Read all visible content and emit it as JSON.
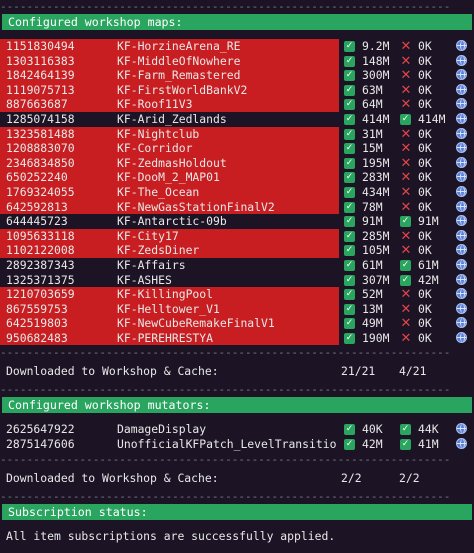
{
  "dash_line": "--------------------------------------------------------------------",
  "maps_header": "Configured workshop maps:",
  "maps": [
    {
      "id": "1151830494",
      "name": "KF-HorzineArena_RE",
      "s1": "9.2M",
      "ok2": false,
      "s2": "0K",
      "red": true
    },
    {
      "id": "1303116383",
      "name": "KF-MiddleOfNowhere",
      "s1": "148M",
      "ok2": false,
      "s2": "0K",
      "red": true
    },
    {
      "id": "1842464139",
      "name": "KF-Farm_Remastered",
      "s1": "300M",
      "ok2": false,
      "s2": "0K",
      "red": true
    },
    {
      "id": "1119075713",
      "name": "KF-FirstWorldBankV2",
      "s1": "63M",
      "ok2": false,
      "s2": "0K",
      "red": true
    },
    {
      "id": "887663687",
      "name": "KF-Roof11V3",
      "s1": "64M",
      "ok2": false,
      "s2": "0K",
      "red": true
    },
    {
      "id": "1285074158",
      "name": "KF-Arid_Zedlands",
      "s1": "414M",
      "ok2": true,
      "s2": "414M",
      "red": false
    },
    {
      "id": "1323581488",
      "name": "KF-Nightclub",
      "s1": "31M",
      "ok2": false,
      "s2": "0K",
      "red": true
    },
    {
      "id": "1208883070",
      "name": "KF-Corridor",
      "s1": "15M",
      "ok2": false,
      "s2": "0K",
      "red": true
    },
    {
      "id": "2346834850",
      "name": "KF-ZedmasHoldout",
      "s1": "195M",
      "ok2": false,
      "s2": "0K",
      "red": true
    },
    {
      "id": "650252240",
      "name": "KF-DooM_2_MAP01",
      "s1": "283M",
      "ok2": false,
      "s2": "0K",
      "red": true
    },
    {
      "id": "1769324055",
      "name": "KF-The_Ocean",
      "s1": "434M",
      "ok2": false,
      "s2": "0K",
      "red": true
    },
    {
      "id": "642592813",
      "name": "KF-NewGasStationFinalV2",
      "s1": "78M",
      "ok2": false,
      "s2": "0K",
      "red": true
    },
    {
      "id": "644445723",
      "name": "KF-Antarctic-09b",
      "s1": "91M",
      "ok2": true,
      "s2": "91M",
      "red": false
    },
    {
      "id": "1095633118",
      "name": "KF-City17",
      "s1": "285M",
      "ok2": false,
      "s2": "0K",
      "red": true
    },
    {
      "id": "1102122008",
      "name": "KF-ZedsDiner",
      "s1": "105M",
      "ok2": false,
      "s2": "0K",
      "red": true
    },
    {
      "id": "2892387343",
      "name": "KF-Affairs",
      "s1": "61M",
      "ok2": true,
      "s2": "61M",
      "red": false
    },
    {
      "id": "1325371375",
      "name": "KF-ASHES",
      "s1": "307M",
      "ok2": true,
      "s2": "42M",
      "red": false
    },
    {
      "id": "1210703659",
      "name": "KF-KillingPool",
      "s1": "52M",
      "ok2": false,
      "s2": "0K",
      "red": true
    },
    {
      "id": "867559753",
      "name": "KF-Helltower_V1",
      "s1": "13M",
      "ok2": false,
      "s2": "0K",
      "red": true
    },
    {
      "id": "642519803",
      "name": "KF-NewCubeRemakeFinalV1",
      "s1": "49M",
      "ok2": false,
      "s2": "0K",
      "red": true
    },
    {
      "id": "950682483",
      "name": "KF-PEREHRESTYA",
      "s1": "190M",
      "ok2": false,
      "s2": "0K",
      "red": true
    }
  ],
  "maps_summary": {
    "label": "Downloaded to Workshop & Cache:",
    "v1": "21/21",
    "v2": "4/21"
  },
  "mutators_header": "Configured workshop mutators:",
  "mutators": [
    {
      "id": "2625647922",
      "name": "DamageDisplay",
      "s1": "40K",
      "ok2": true,
      "s2": "44K",
      "red": false
    },
    {
      "id": "2875147606",
      "name": "UnofficialKFPatch_LevelTransitio",
      "s1": "42M",
      "ok2": true,
      "s2": "41M",
      "red": false
    }
  ],
  "mutators_summary": {
    "label": "Downloaded to Workshop & Cache:",
    "v1": "2/2",
    "v2": "2/2"
  },
  "status_header": "Subscription status:",
  "status_message": "All item subscriptions are successfully applied.",
  "icons": {
    "ok": "check-icon",
    "fail": "x-icon",
    "web": "globe-icon"
  },
  "colors": {
    "header_bg": "#2aa55f",
    "row_fail_bg": "#c81e22",
    "bg": "#1c1424",
    "x": "#e0454a"
  }
}
